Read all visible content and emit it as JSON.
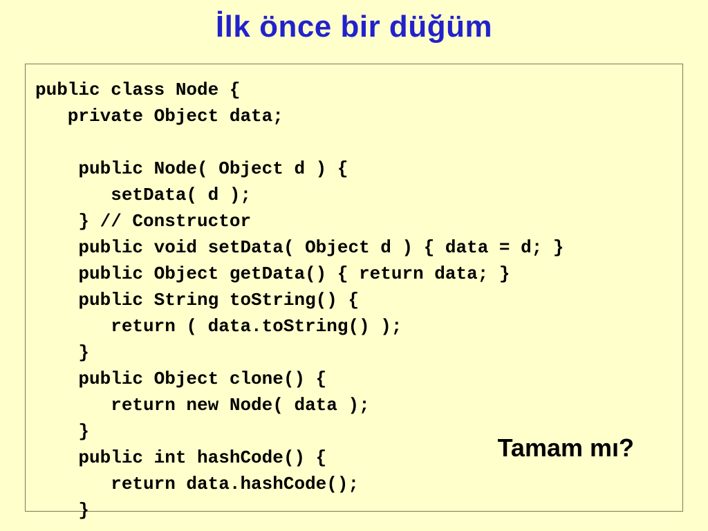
{
  "title": "İlk önce bir düğüm",
  "code_lines": [
    "public class Node {",
    "   private Object data;",
    "",
    "    public Node( Object d ) {",
    "       setData( d );",
    "    } // Constructor",
    "    public void setData( Object d ) { data = d; }",
    "    public Object getData() { return data; }",
    "    public String toString() {",
    "       return ( data.toString() );",
    "    }",
    "    public Object clone() {",
    "       return new Node( data );",
    "    }",
    "    public int hashCode() {",
    "       return data.hashCode();",
    "    }"
  ],
  "question": "Tamam mı?"
}
